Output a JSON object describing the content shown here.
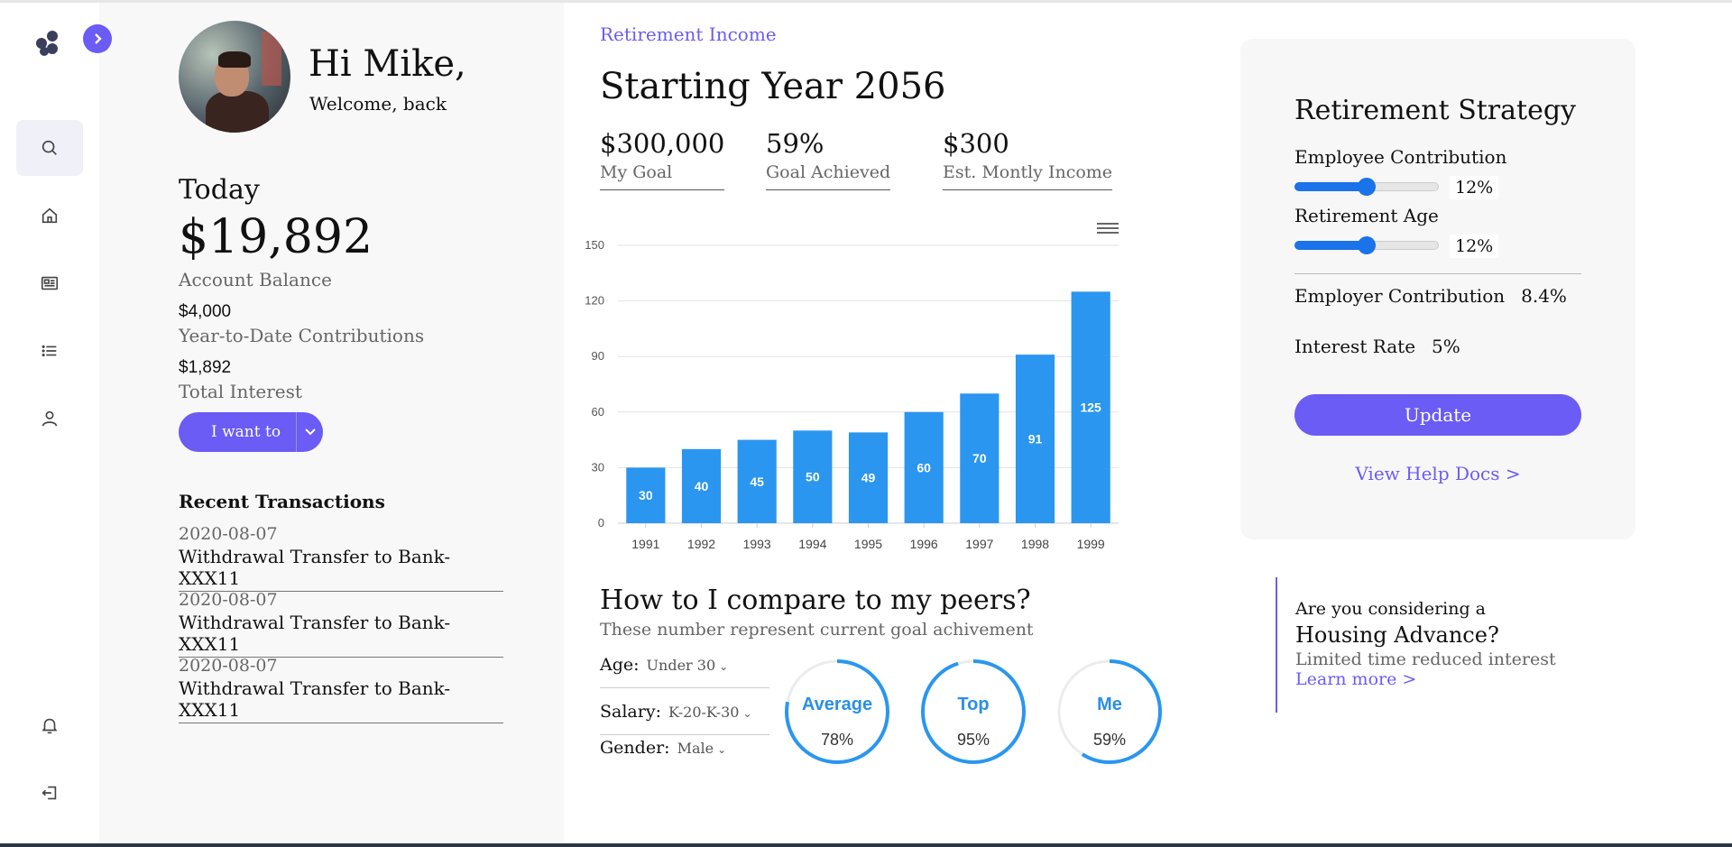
{
  "profile": {
    "greeting": "Hi Mike,",
    "welcome": "Welcome, back",
    "today_label": "Today",
    "balance": "$19,892",
    "balance_label": "Account Balance",
    "ytd_value": "$4,000",
    "ytd_label": "Year-to-Date Contributions",
    "interest_value": "$1,892",
    "interest_label": "Total Interest",
    "iwant_label": "I want to"
  },
  "transactions": {
    "title": "Recent Transactions",
    "items": [
      {
        "date": "2020-08-07",
        "desc": "Withdrawal Transfer to Bank-XXX11"
      },
      {
        "date": "2020-08-07",
        "desc": "Withdrawal Transfer to Bank-XXX11"
      },
      {
        "date": "2020-08-07",
        "desc": "Withdrawal Transfer to Bank-XXX11"
      }
    ]
  },
  "main": {
    "breadcrumb": "Retirement Income",
    "title": "Starting Year 2056",
    "stats": [
      {
        "value": "$300,000",
        "label": "My Goal"
      },
      {
        "value": "59%",
        "label": "Goal Achieved"
      },
      {
        "value": "$300",
        "label": "Est. Montly Income"
      }
    ]
  },
  "chart_data": {
    "type": "bar",
    "categories": [
      "1991",
      "1992",
      "1993",
      "1994",
      "1995",
      "1996",
      "1997",
      "1998",
      "1999"
    ],
    "values": [
      30,
      40,
      45,
      50,
      49,
      60,
      70,
      91,
      125
    ],
    "ylim": [
      0,
      150
    ],
    "yticks": [
      0,
      30,
      60,
      90,
      120,
      150
    ],
    "grid": true,
    "bar_color": "#2a96f0"
  },
  "peers": {
    "title": "How to I compare to my peers?",
    "subtitle": "These number represent current goal achivement",
    "filters": [
      {
        "label": "Age:",
        "value": "Under 30"
      },
      {
        "label": "Salary:",
        "value": "K-20-K-30"
      },
      {
        "label": "Gender:",
        "value": "Male"
      }
    ],
    "rings": [
      {
        "name": "Average",
        "pct_label": "78%",
        "pct": 0.78
      },
      {
        "name": "Top",
        "pct_label": "95%",
        "pct": 0.95
      },
      {
        "name": "Me",
        "pct_label": "59%",
        "pct": 0.59
      }
    ]
  },
  "strategy": {
    "title": "Retirement Strategy",
    "employee_label": "Employee Contribution",
    "employee_value": "12%",
    "employee_level": 0.5,
    "age_label": "Retirement Age",
    "age_value": "12%",
    "age_level": 0.5,
    "employer_label": "Employer Contribution",
    "employer_value": "8.4%",
    "interest_label": "Interest Rate",
    "interest_value": "5%",
    "update_label": "Update",
    "help_label": "View Help Docs >"
  },
  "promo": {
    "line1": "Are you considering a",
    "line2": "Housing Advance?",
    "line3": "Limited time reduced interest",
    "link": "Learn more >"
  },
  "colors": {
    "accent": "#6a5cf5",
    "bar": "#2a96f0",
    "slider": "#1a73e8"
  }
}
